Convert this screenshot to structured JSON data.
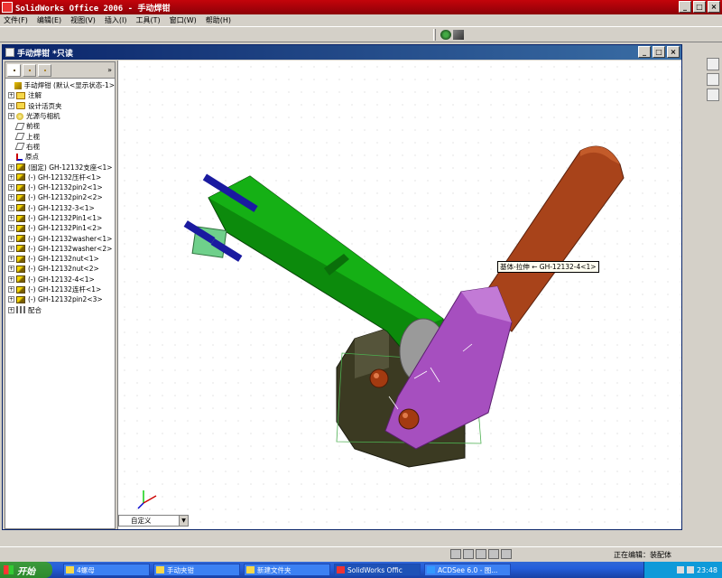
{
  "app": {
    "title": "SolidWorks Office 2006 - 手动焊钳",
    "window_buttons": [
      "_",
      "□",
      "×"
    ]
  },
  "menu": [
    "文件(F)",
    "编辑(E)",
    "视图(V)",
    "插入(I)",
    "工具(T)",
    "窗口(W)",
    "帮助(H)"
  ],
  "document": {
    "title": "手动焊钳 *只读",
    "window_buttons": [
      "_",
      "□",
      "×"
    ]
  },
  "feature_tree": {
    "more": "»",
    "items": [
      {
        "label": "手动焊钳  (默认<显示状态-1>",
        "icon": "assembly-icon",
        "exp": "",
        "cls": "assy"
      },
      {
        "label": "注解",
        "icon": "annotation-icon",
        "exp": "+",
        "cls": "annot"
      },
      {
        "label": "设计活页夹",
        "icon": "folder-icon",
        "exp": "+",
        "cls": "folder"
      },
      {
        "label": "光源与相机",
        "icon": "light-icon",
        "exp": "+",
        "cls": "light"
      },
      {
        "label": "前视",
        "icon": "plane-icon",
        "exp": "",
        "cls": "plane"
      },
      {
        "label": "上视",
        "icon": "plane-icon",
        "exp": "",
        "cls": "plane"
      },
      {
        "label": "右视",
        "icon": "plane-icon",
        "exp": "",
        "cls": "plane"
      },
      {
        "label": "原点",
        "icon": "origin-icon",
        "exp": "",
        "cls": "origin"
      },
      {
        "label": "(固定) GH-12132支座<1>",
        "icon": "part-icon",
        "exp": "+",
        "cls": "part"
      },
      {
        "label": "(-) GH-12132压杆<1>",
        "icon": "part-icon",
        "exp": "+",
        "cls": "part"
      },
      {
        "label": "(-) GH-12132pin2<1>",
        "icon": "part-icon",
        "exp": "+",
        "cls": "part"
      },
      {
        "label": "(-) GH-12132pin2<2>",
        "icon": "part-icon",
        "exp": "+",
        "cls": "part"
      },
      {
        "label": "(-) GH-12132-3<1>",
        "icon": "part-icon",
        "exp": "+",
        "cls": "part"
      },
      {
        "label": "(-) GH-12132Pin1<1>",
        "icon": "part-icon",
        "exp": "+",
        "cls": "part"
      },
      {
        "label": "(-) GH-12132Pin1<2>",
        "icon": "part-icon",
        "exp": "+",
        "cls": "part"
      },
      {
        "label": "(-) GH-12132washer<1>",
        "icon": "part-icon",
        "exp": "+",
        "cls": "part"
      },
      {
        "label": "(-) GH-12132washer<2>",
        "icon": "part-icon",
        "exp": "+",
        "cls": "part"
      },
      {
        "label": "(-) GH-12132nut<1>",
        "icon": "part-icon",
        "exp": "+",
        "cls": "part"
      },
      {
        "label": "(-) GH-12132nut<2>",
        "icon": "part-icon",
        "exp": "+",
        "cls": "part"
      },
      {
        "label": "(-) GH-12132-4<1>",
        "icon": "part-icon",
        "exp": "+",
        "cls": "part"
      },
      {
        "label": "(-) GH-12132连杆<1>",
        "icon": "part-icon",
        "exp": "+",
        "cls": "part"
      },
      {
        "label": "(-) GH-12132pin2<3>",
        "icon": "part-icon",
        "exp": "+",
        "cls": "part"
      },
      {
        "label": "配合",
        "icon": "mate-icon",
        "exp": "+",
        "cls": "mate"
      }
    ]
  },
  "graphics": {
    "tooltip": "基体-拉伸 ← GH-12132-4<1>",
    "view_orientation": "自定义",
    "colors": {
      "arm": "#0c8a0c",
      "handle": "#a8431a",
      "link": "#a64fbf",
      "base": "#3b3a22",
      "pin": "#a33a10",
      "washer": "#1a1aa0"
    }
  },
  "status": {
    "text": "正在编辑：装配体"
  },
  "taskbar": {
    "start": "开始",
    "tasks": [
      "4螺母",
      "手动夹钳",
      "新建文件夹",
      "SolidWorks Offic",
      "ACDSee 6.0 - 图..."
    ],
    "time": "23:48"
  }
}
